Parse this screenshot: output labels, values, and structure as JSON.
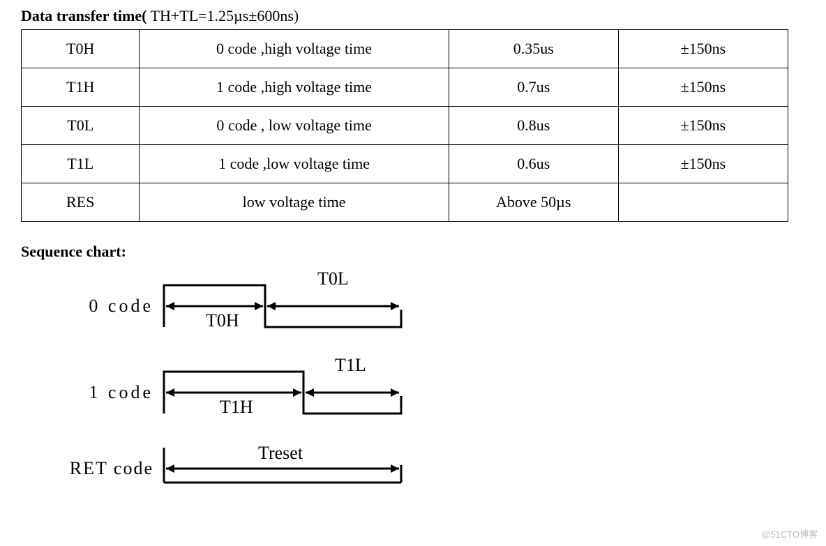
{
  "heading_bold": "Data transfer time(",
  "heading_rest": " TH+TL=1.25µs±600ns)",
  "table": {
    "rows": [
      {
        "sym": "T0H",
        "desc": "0 code ,high voltage time",
        "val": "0.35us",
        "tol": "±150ns"
      },
      {
        "sym": "T1H",
        "desc": "1 code ,high voltage time",
        "val": "0.7us",
        "tol": "±150ns"
      },
      {
        "sym": "T0L",
        "desc": "0 code , low voltage time",
        "val": "0.8us",
        "tol": "±150ns"
      },
      {
        "sym": "T1L",
        "desc": "1 code ,low voltage time",
        "val": "0.6us",
        "tol": "±150ns"
      },
      {
        "sym": "RES",
        "desc": "low voltage time",
        "val": "Above 50µs",
        "tol": ""
      }
    ]
  },
  "sequence_heading": "Sequence chart:",
  "seq": {
    "code0_label": "0 code",
    "code0_high": "T0H",
    "code0_low": "T0L",
    "code1_label": "1 code",
    "code1_high": "T1H",
    "code1_low": "T1L",
    "ret_label": "RET code",
    "ret_span": "Treset"
  },
  "watermark": "@51CTO博客"
}
